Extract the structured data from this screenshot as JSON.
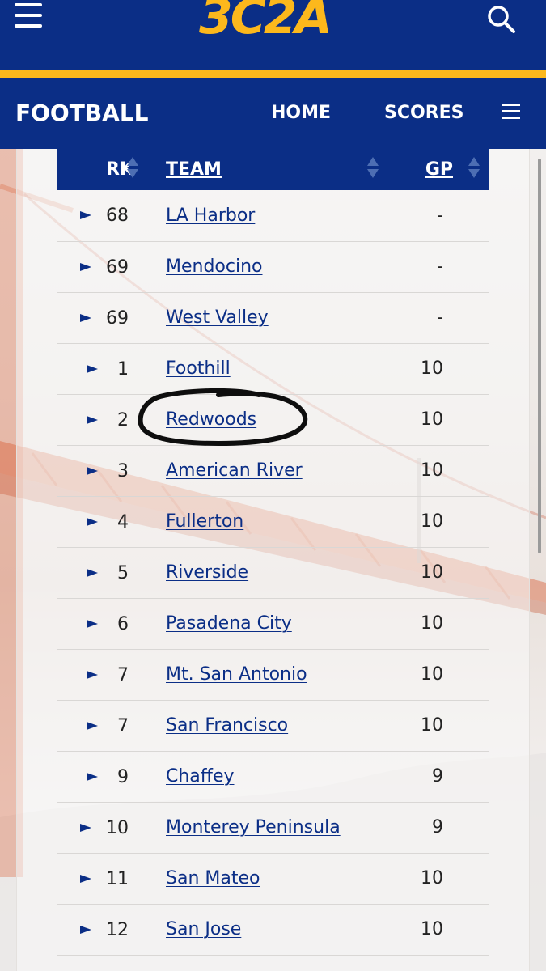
{
  "header": {
    "logo_text": "3C2A",
    "menu_icon": "hamburger-icon",
    "search_icon": "search-icon",
    "brand_color": "#0b2e86",
    "accent_color": "#fcb81c"
  },
  "section_nav": {
    "title": "FOOTBALL",
    "links": [
      "HOME",
      "SCORES"
    ],
    "menu_icon": "hamburger-icon"
  },
  "table": {
    "columns": [
      "RK",
      "TEAM",
      "GP"
    ],
    "rows": [
      {
        "rk": "68",
        "team": "LA Harbor",
        "gp": "-"
      },
      {
        "rk": "69",
        "team": "Mendocino",
        "gp": "-"
      },
      {
        "rk": "69",
        "team": "West Valley",
        "gp": "-"
      },
      {
        "rk": "1",
        "team": "Foothill",
        "gp": "10"
      },
      {
        "rk": "2",
        "team": "Redwoods",
        "gp": "10"
      },
      {
        "rk": "3",
        "team": "American River",
        "gp": "10"
      },
      {
        "rk": "4",
        "team": "Fullerton",
        "gp": "10"
      },
      {
        "rk": "5",
        "team": "Riverside",
        "gp": "10"
      },
      {
        "rk": "6",
        "team": "Pasadena City",
        "gp": "10"
      },
      {
        "rk": "7",
        "team": "Mt. San Antonio",
        "gp": "10"
      },
      {
        "rk": "7",
        "team": "San Francisco",
        "gp": "10"
      },
      {
        "rk": "9",
        "team": "Chaffey",
        "gp": "9"
      },
      {
        "rk": "10",
        "team": "Monterey Peninsula",
        "gp": "9"
      },
      {
        "rk": "11",
        "team": "San Mateo",
        "gp": "10"
      },
      {
        "rk": "12",
        "team": "San Jose",
        "gp": "10"
      }
    ]
  }
}
